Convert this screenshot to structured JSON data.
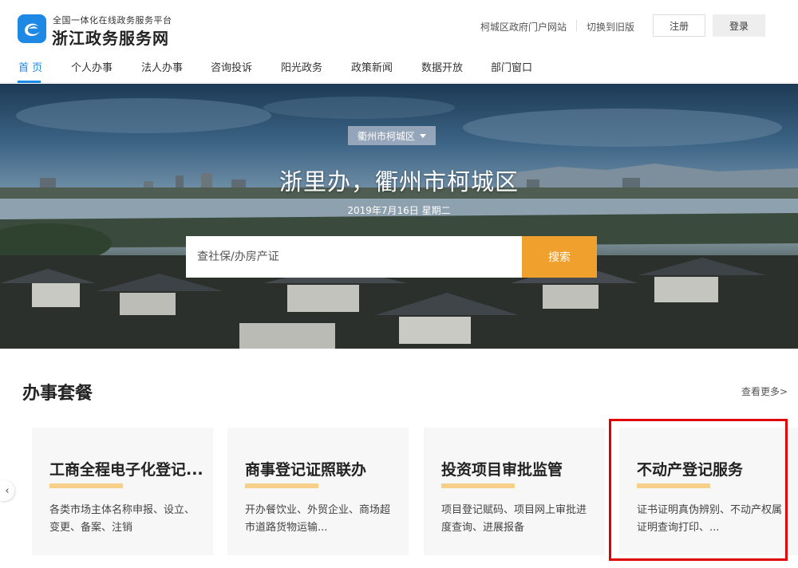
{
  "header": {
    "platform_subtitle": "全国一体化在线政务服务平台",
    "site_name": "浙江政务服务网",
    "portal_link": "柯城区政府门户网站",
    "old_version_link": "切换到旧版",
    "register_label": "注册",
    "login_label": "登录"
  },
  "nav": {
    "items": [
      "首 页",
      "个人办事",
      "法人办事",
      "咨询投诉",
      "阳光政务",
      "政策新闻",
      "数据开放",
      "部门窗口"
    ],
    "active_index": 0
  },
  "banner": {
    "region": "衢州市柯城区",
    "title": "浙里办，衢州市柯城区",
    "date": "2019年7月16日 星期二",
    "search_placeholder": "查社保/办房产证",
    "search_button": "搜索"
  },
  "section": {
    "title": "办事套餐",
    "more_link": "查看更多>"
  },
  "cards": [
    {
      "title": "工商全程电子化登记...",
      "desc": "各类市场主体名称申报、设立、变更、备案、注销"
    },
    {
      "title": "商事登记证照联办",
      "desc": "开办餐饮业、外贸企业、商场超市道路货物运输..."
    },
    {
      "title": "投资项目审批监管",
      "desc": "项目登记赋码、项目网上审批进度查询、进展报备"
    },
    {
      "title": "不动产登记服务",
      "desc": "证书证明真伪辨别、不动产权属证明查询打印、..."
    }
  ],
  "colors": {
    "brand_blue": "#1e88e5",
    "search_orange": "#f0a02c",
    "card_bar": "#f6d088",
    "highlight_red": "#e00000"
  },
  "icons": {
    "logo": "zhejiang-gov-logo-icon",
    "carousel_prev": "chevron-left-icon",
    "dropdown": "caret-down-icon"
  }
}
